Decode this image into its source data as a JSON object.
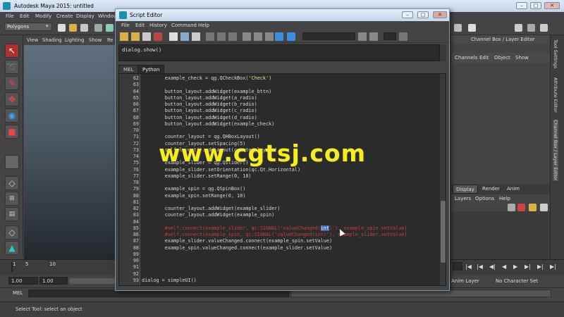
{
  "maya": {
    "title": "Autodesk Maya 2015: untitled",
    "menus": [
      "File",
      "Edit",
      "Modify",
      "Create",
      "Display",
      "Window"
    ],
    "mode_select": "Polygons",
    "viewport_menus": [
      "View",
      "Shading",
      "Lighting",
      "Show",
      "Re"
    ],
    "range_start": "1.00",
    "range_end": "1.00",
    "timeline_ticks": [
      "1",
      "5",
      "10"
    ],
    "cmd_label": "MEL",
    "help_text": "Select Tool: select an object",
    "anim_layer": "Anim Layer",
    "char_set": "No Character Set"
  },
  "channel_box": {
    "title": "Channel Box / Layer Editor",
    "menus": [
      "Channels",
      "Edit",
      "Object",
      "Show"
    ],
    "layer_tabs": [
      "Display",
      "Render",
      "Anim"
    ],
    "layer_menus": [
      "Layers",
      "Options",
      "Help"
    ],
    "side_tabs": [
      "Tool Settings",
      "Attribute Editor",
      "Channel Box / Layer Editor"
    ]
  },
  "script_editor": {
    "title": "Script Editor",
    "menus": [
      "File",
      "Edit",
      "History",
      "Command",
      "Help"
    ],
    "output_line": "dialog.show()",
    "tabs": [
      "MEL",
      "Python"
    ],
    "active_tab": "Python",
    "lines": [
      {
        "n": "62",
        "t": "        example_check = qg.QCheckBox(",
        "s": "'Check'",
        "e": ")",
        "kind": "str"
      },
      {
        "n": "63",
        "t": "",
        "kind": "plain"
      },
      {
        "n": "64",
        "t": "        button_layout.addWidget(example_bttn)",
        "kind": "plain"
      },
      {
        "n": "65",
        "t": "        button_layout.addWidget(a_radio)",
        "kind": "plain"
      },
      {
        "n": "66",
        "t": "        button_layout.addWidget(b_radio)",
        "kind": "plain"
      },
      {
        "n": "67",
        "t": "        button_layout.addWidget(c_radio)",
        "kind": "plain"
      },
      {
        "n": "68",
        "t": "        button_layout.addWidget(d_radio)",
        "kind": "plain"
      },
      {
        "n": "69",
        "t": "        button_layout.addWidget(example_check)",
        "kind": "plain"
      },
      {
        "n": "70",
        "t": "",
        "kind": "plain"
      },
      {
        "n": "71",
        "t": "        counter_layout = qg.QHBoxLayout()",
        "kind": "plain"
      },
      {
        "n": "72",
        "t": "        counter_layout.setSpacing(5)",
        "kind": "plain"
      },
      {
        "n": "73",
        "t": "        self.layout().addLayout(counter_layout)",
        "kind": "plain"
      },
      {
        "n": "74",
        "t": "",
        "kind": "plain"
      },
      {
        "n": "75",
        "t": "        example_slider = qg.QSlider()",
        "kind": "plain"
      },
      {
        "n": "76",
        "t": "        example_slider.setOrientation(qc.Qt.Horizontal)",
        "kind": "plain"
      },
      {
        "n": "77",
        "t": "        example_slider.setRange(0, 10)",
        "kind": "plain"
      },
      {
        "n": "78",
        "t": "",
        "kind": "plain"
      },
      {
        "n": "79",
        "t": "        example_spin = qg.QSpinBox()",
        "kind": "plain"
      },
      {
        "n": "80",
        "t": "        example_spin.setRange(0, 10)",
        "kind": "plain"
      },
      {
        "n": "81",
        "t": "",
        "kind": "plain"
      },
      {
        "n": "82",
        "t": "        counter_layout.addWidget(example_slider)",
        "kind": "plain"
      },
      {
        "n": "83",
        "t": "        counter_layout.addWidget(example_spin)",
        "kind": "plain"
      },
      {
        "n": "84",
        "t": "",
        "kind": "plain"
      },
      {
        "n": "85",
        "t": "        #self.connect(example_slider, qc.SIGNAL('valueChanged(int)'), example_spin.setValue)",
        "kind": "comment"
      },
      {
        "n": "86",
        "t": "        #self.connect(example_spin, qc.SIGNAL('valueChanged(int)'), example_slider.setValue)",
        "kind": "comment"
      },
      {
        "n": "87",
        "t": "        example_slider.valueChanged.connect(example_spin.setValue)",
        "kind": "plain"
      },
      {
        "n": "88",
        "t": "        example_spin.valueChanged.connect(example_slider.setValue)",
        "kind": "plain"
      },
      {
        "n": "89",
        "t": "",
        "kind": "plain"
      },
      {
        "n": "90",
        "t": "",
        "kind": "plain"
      },
      {
        "n": "91",
        "t": "",
        "kind": "plain"
      },
      {
        "n": "92",
        "t": "",
        "kind": "plain"
      },
      {
        "n": "93",
        "t": "dialog = simpleUI()",
        "kind": "plain"
      }
    ]
  },
  "watermark": "www.cgtsj.com"
}
